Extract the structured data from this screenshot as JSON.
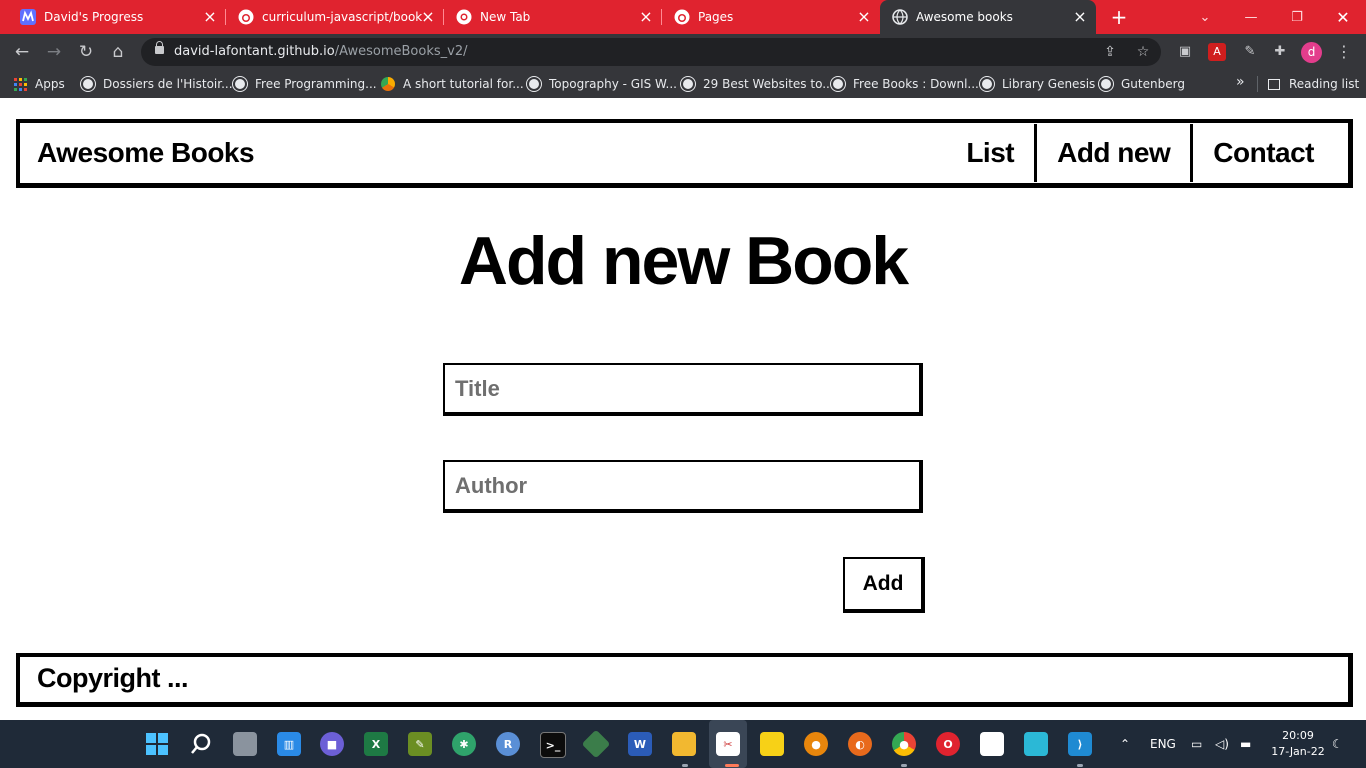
{
  "browser": {
    "tabs": [
      {
        "title": "David's Progress",
        "icon": "microverse-icon",
        "active": false
      },
      {
        "title": "curriculum-javascript/books...",
        "icon": "github-icon",
        "active": false
      },
      {
        "title": "New Tab",
        "icon": "chrome-icon",
        "active": false
      },
      {
        "title": "Pages",
        "icon": "github-icon",
        "active": false
      },
      {
        "title": "Awesome books",
        "icon": "globe-icon",
        "active": true
      }
    ],
    "url_host": "david-lafontant.github.io",
    "url_path": "/AwesomeBooks_v2/",
    "profile_initial": "d",
    "bookmarks": [
      {
        "label": "Apps",
        "icon": "apps-grid-icon"
      },
      {
        "label": "Dossiers de l'Histoir...",
        "icon": "globe-icon"
      },
      {
        "label": "Free Programming...",
        "icon": "globe-icon"
      },
      {
        "label": "A short tutorial for...",
        "icon": "colab-icon"
      },
      {
        "label": "Topography - GIS W...",
        "icon": "globe-icon"
      },
      {
        "label": "29 Best Websites to...",
        "icon": "globe-icon"
      },
      {
        "label": "Free Books : Downl...",
        "icon": "globe-icon"
      },
      {
        "label": "Library Genesis",
        "icon": "globe-icon"
      },
      {
        "label": "Gutenberg",
        "icon": "globe-icon"
      }
    ],
    "reading_list": "Reading list"
  },
  "page": {
    "brand": "Awesome Books",
    "nav": [
      "List",
      "Add new",
      "Contact"
    ],
    "heading": "Add new Book",
    "title_placeholder": "Title",
    "author_placeholder": "Author",
    "add_button": "Add",
    "footer": "Copyright ..."
  },
  "taskbar": {
    "language": "ENG",
    "time": "20:09",
    "date": "17-Jan-22"
  },
  "colors": {
    "tab_strip": "#e0232f",
    "toolbar": "#35363a",
    "taskbar": "#1f2a38",
    "page_ink": "#000000"
  }
}
